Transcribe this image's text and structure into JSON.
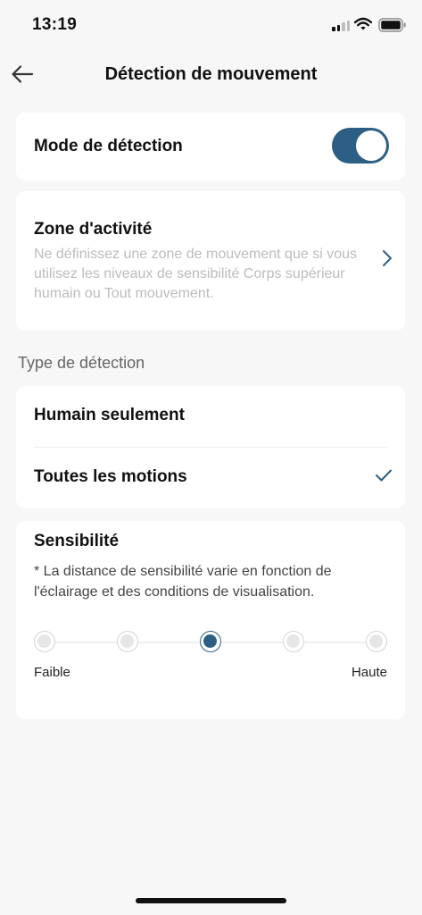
{
  "status": {
    "time": "13:19"
  },
  "header": {
    "title": "Détection de mouvement"
  },
  "mode": {
    "label": "Mode de détection",
    "enabled": true
  },
  "zone": {
    "title": "Zone d'activité",
    "description": "Ne définissez une zone de mouvement que si vous utilisez les niveaux de sensibilité Corps supérieur humain ou Tout mouvement."
  },
  "detection_type": {
    "section_label": "Type de détection",
    "options": [
      {
        "label": "Humain seulement",
        "selected": false
      },
      {
        "label": "Toutes les motions",
        "selected": true
      }
    ]
  },
  "sensitivity": {
    "title": "Sensibilité",
    "note": "* La distance de sensibilité varie en fonction de l'éclairage et des conditions de visualisation.",
    "levels": 5,
    "selected_level": 3,
    "low_label": "Faible",
    "high_label": "Haute"
  },
  "colors": {
    "accent": "#2d5f84",
    "background": "#f7f7f7"
  }
}
